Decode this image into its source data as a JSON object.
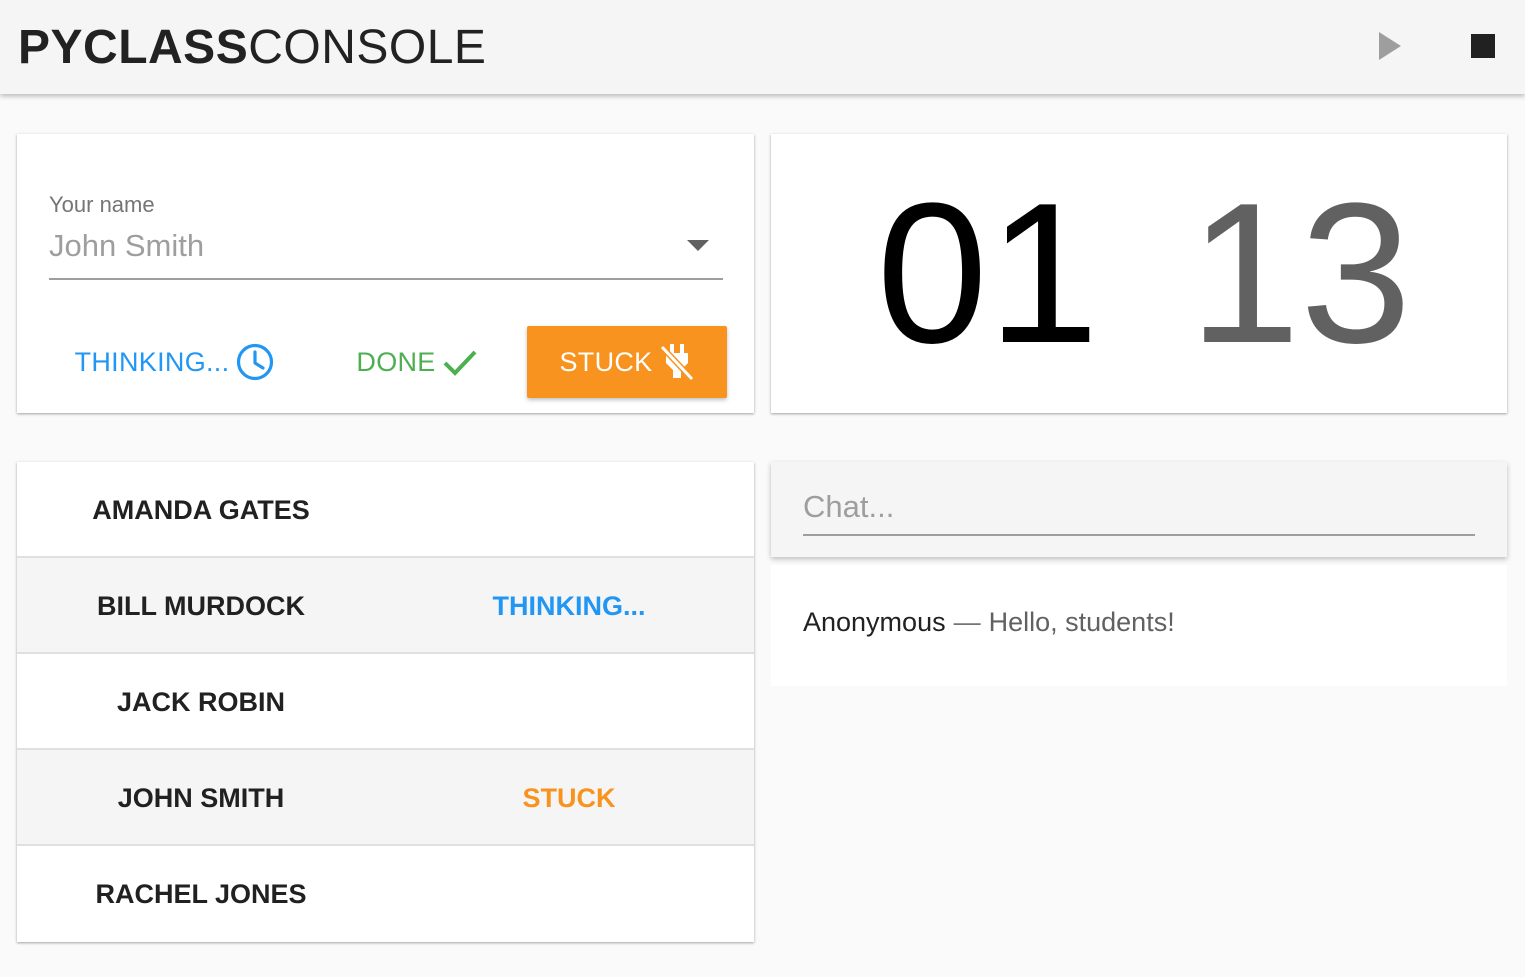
{
  "header": {
    "brand_bold": "PYCLASS",
    "brand_light": "CONSOLE",
    "play_icon": "play-icon",
    "stop_icon": "stop-icon"
  },
  "status_panel": {
    "name_label": "Your name",
    "name_value": "John Smith",
    "buttons": {
      "thinking": "THINKING...",
      "done": "DONE",
      "stuck": "STUCK"
    },
    "icons": {
      "thinking": "clock-icon",
      "done": "check-icon",
      "stuck": "plug-off-icon"
    }
  },
  "timer": {
    "minutes": "01",
    "seconds": "13"
  },
  "students": [
    {
      "name": "AMANDA GATES",
      "status": ""
    },
    {
      "name": "BILL MURDOCK",
      "status": "THINKING..."
    },
    {
      "name": "JACK ROBIN",
      "status": ""
    },
    {
      "name": "JOHN SMITH",
      "status": "STUCK"
    },
    {
      "name": "RACHEL JONES",
      "status": ""
    }
  ],
  "chat": {
    "placeholder": "Chat...",
    "messages": [
      {
        "author": "Anonymous",
        "separator": "—",
        "text": "Hello, students!"
      }
    ]
  },
  "colors": {
    "thinking": "#2196f3",
    "done": "#4caf50",
    "stuck": "#f7931e",
    "background": "#fafafa"
  }
}
